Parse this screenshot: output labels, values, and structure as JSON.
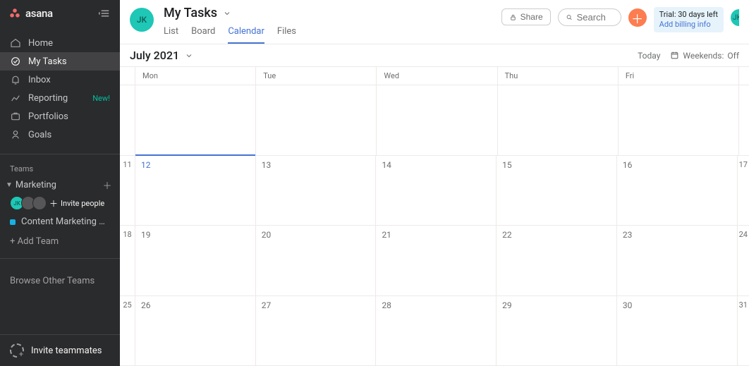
{
  "brand": {
    "name": "asana"
  },
  "sidebar": {
    "nav": {
      "home": "Home",
      "mytasks": "My Tasks",
      "inbox": "Inbox",
      "reporting": "Reporting",
      "reporting_new": "New!",
      "portfolios": "Portfolios",
      "goals": "Goals"
    },
    "teams_label": "Teams",
    "team": {
      "name": "Marketing",
      "project": "Content Marketing Pla...",
      "avatar_initials": "JK",
      "invite_people": "Invite people"
    },
    "add_team": "+ Add Team",
    "browse": "Browse Other Teams",
    "invite_teammates": "Invite teammates"
  },
  "header": {
    "avatar_initials": "JK",
    "title": "My Tasks",
    "tabs": {
      "list": "List",
      "board": "Board",
      "calendar": "Calendar",
      "files": "Files"
    },
    "share": "Share",
    "search_placeholder": "Search",
    "trial_line1": "Trial: 30 days left",
    "trial_line2": "Add billing info",
    "mini_avatar_initials": "JK"
  },
  "period": {
    "month": "July 2021",
    "today": "Today",
    "weekends_label": "Weekends:",
    "weekends_value": "Off"
  },
  "calendar": {
    "day_headers": [
      "Mon",
      "Tue",
      "Wed",
      "Thu",
      "Fri"
    ],
    "rows": [
      {
        "week": "",
        "days": [
          "",
          "",
          "",
          "",
          ""
        ],
        "edge": ""
      },
      {
        "week": "11",
        "days": [
          "12",
          "13",
          "14",
          "15",
          "16"
        ],
        "edge": "17",
        "today_index": 0
      },
      {
        "week": "18",
        "days": [
          "19",
          "20",
          "21",
          "22",
          "23"
        ],
        "edge": "24"
      },
      {
        "week": "25",
        "days": [
          "26",
          "27",
          "28",
          "29",
          "30"
        ],
        "edge": "31"
      }
    ]
  }
}
